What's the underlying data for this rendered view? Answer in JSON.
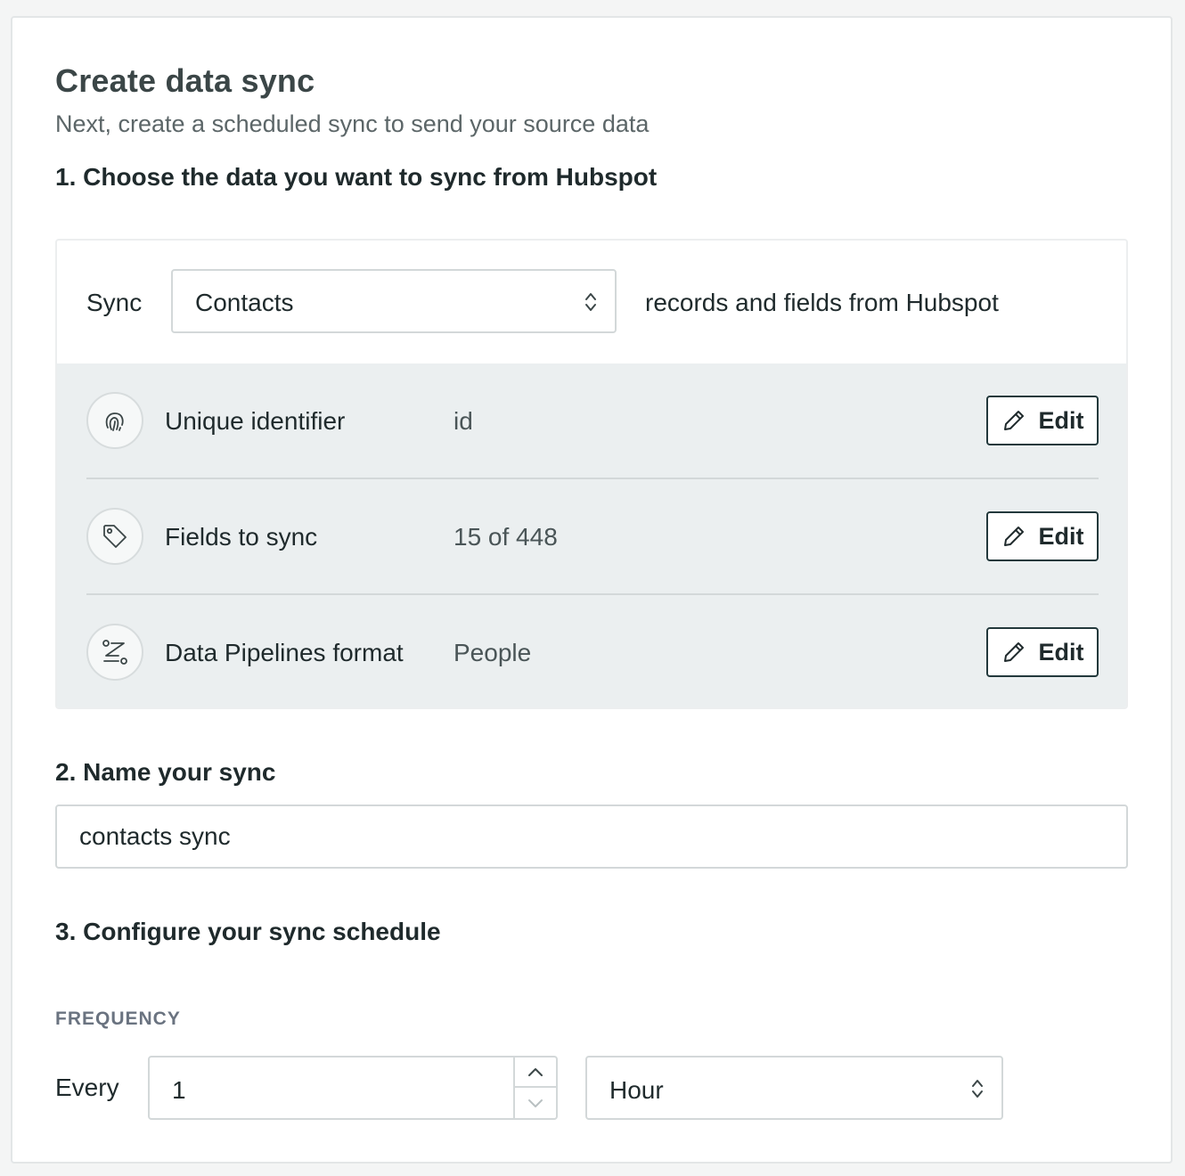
{
  "header": {
    "title": "Create data sync",
    "subtitle": "Next, create a scheduled sync to send your source data"
  },
  "steps": {
    "step1": "1. Choose the data you want to sync from Hubspot",
    "step2": "2. Name your sync",
    "step3": "3. Configure your sync schedule"
  },
  "sync": {
    "label": "Sync",
    "object_value": "Contacts",
    "suffix": "records and fields from Hubspot"
  },
  "rows": [
    {
      "label": "Unique identifier",
      "value": "id",
      "icon": "fingerprint-icon",
      "edit_label": "Edit"
    },
    {
      "label": "Fields to sync",
      "value": "15 of 448",
      "icon": "tag-icon",
      "edit_label": "Edit"
    },
    {
      "label": "Data Pipelines format",
      "value": "People",
      "icon": "transform-icon",
      "edit_label": "Edit"
    }
  ],
  "name_input": {
    "value": "contacts sync"
  },
  "schedule": {
    "frequency_label": "FREQUENCY",
    "every_label": "Every",
    "interval_value": "1",
    "unit_value": "Hour"
  },
  "colors": {
    "panel_background": "#ebeff0",
    "button_border": "#23393c",
    "frequency_label": "#6a7380"
  }
}
